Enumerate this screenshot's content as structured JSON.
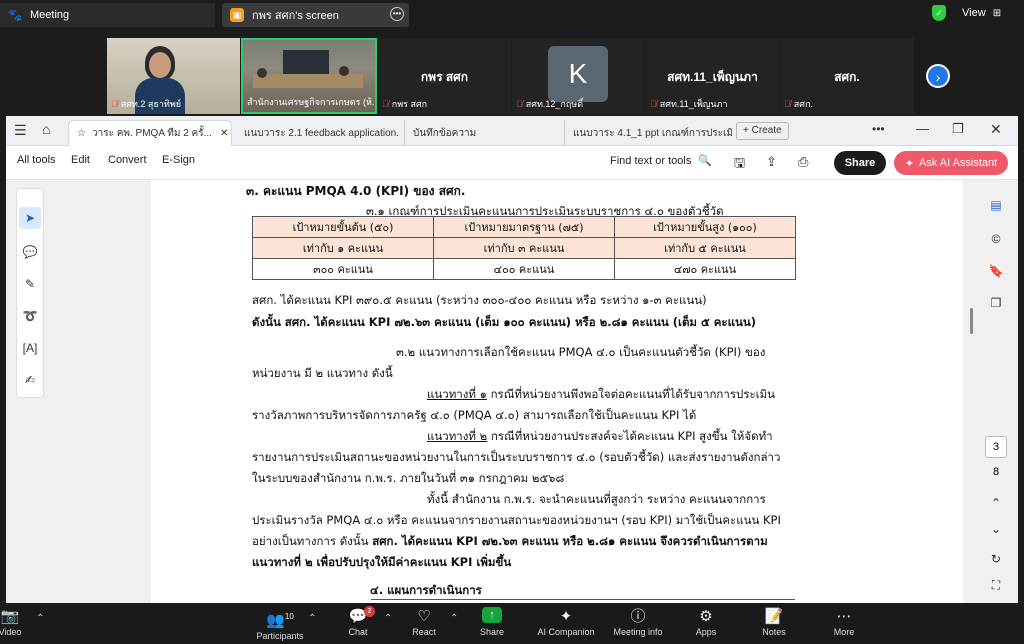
{
  "zoom_top": {
    "meeting_label": "Meeting",
    "share_label": "กพร สศก's screen",
    "view_label": "View"
  },
  "gallery": {
    "tiles": [
      {
        "name": "สศท.2 สุธาทิพย์"
      },
      {
        "name": "สำนักงานเศรษฐกิจการเกษตร (ห้..."
      },
      {
        "title": "กพร สศก",
        "name": "กพร สศก"
      },
      {
        "avatar_letter": "K",
        "name": "สศท.12_กฤษดิ์"
      },
      {
        "title": "สศท.11_เพ็ญนภา",
        "name": "สศท.11_เพ็ญนภา"
      },
      {
        "title": "สศก.",
        "name": "สศก."
      }
    ]
  },
  "browser": {
    "tabs": [
      "วาระ คพ. PMQA ทีม 2 ครั้...",
      "แนบวาระ 2.1 feedback application...",
      "บันทึกข้อความ",
      "แนบวาระ 4.1_1 ppt เกณฑ์การประเมิน ...",
      "Create"
    ],
    "menu": [
      "All tools",
      "Edit",
      "Convert",
      "E-Sign"
    ],
    "find_label": "Find text or tools",
    "share_label": "Share",
    "ai_label": "Ask AI Assistant"
  },
  "doc": {
    "h3": "๓. คะแนน PMQA 4.0 (KPI) ของ สศก.",
    "s31": "๓.๑ เกณฑ์การประเมินคะแนนการประเมินระบบราชการ ๔.๐ ของตัวชี้วัด",
    "table": {
      "headers": [
        "เป้าหมายขั้นต้น (๕๐)",
        "เป้าหมายมาตรฐาน (๗๕)",
        "เป้าหมายขั้นสูง (๑๐๐)"
      ],
      "row2": [
        "เท่ากับ ๑ คะแนน",
        "เท่ากับ ๓ คะแนน",
        "เท่ากับ ๕ คะแนน"
      ],
      "row3": [
        "๓๐๐ คะแนน",
        "๔๐๐ คะแนน",
        "๔๗๐ คะแนน"
      ]
    },
    "p1": "สศก. ได้คะแนน KPI ๓๙๐.๕ คะแนน (ระหว่าง ๓๐๐-๔๐๐ คะแนน หรือ ระหว่าง ๑-๓ คะแนน)",
    "p2": "ดังนั้น สศก. ได้คะแนน KPI ๗๒.๖๓ คะแนน (เต็ม ๑๐๐ คะแนน) หรือ ๒.๘๑ คะแนน (เต็ม ๕ คะแนน)",
    "s32a": "๓.๒ แนวทางการเลือกใช้คะแนน PMQA ๔.๐ เป็นคะแนนตัวชี้วัด (KPI) ของ",
    "s32b": "หน่วยงาน มี ๒ แนวทาง ดังนี้",
    "w1_label": "แนวทางที่ ๑",
    "w1_text": "กรณีที่หน่วยงานพึงพอใจต่อคะแนนที่ได้รับจากการประเมิน",
    "w1b": "รางวัลภาพการบริหารจัดการภาครัฐ ๔.๐ (PMQA ๔.๐) สามารถเลือกใช้เป็นคะแนน KPI ได้",
    "w2_label": "แนวทางที่ ๒",
    "w2_text": "กรณีที่หน่วยงานประสงค์จะได้คะแนน KPI สูงขึ้น ให้จัดทำ",
    "w2b": "รายงานการประเมินสถานะของหน่วยงานในการเป็นระบบราชการ ๔.๐ (รอบตัวชี้วัด) และส่งรายงานดังกล่าว",
    "w2c": "ในระบบของสำนักงาน ก.พ.ร. ภายในวันที่ ๓๑ กรกฎาคม ๒๕๖๘",
    "c1": "ทั้งนี้ สำนักงาน ก.พ.ร. จะนำคะแนนที่สูงกว่า ระหว่าง คะแนนจากการ",
    "c2": "ประเมินรางวัล PMQA ๔.๐ หรือ คะแนนจากรายงานสถานะของหน่วยงานฯ (รอบ KPI) มาใช้เป็นคะแนน KPI",
    "c3a": "อย่างเป็นทางการ ดังนั้น",
    "c3b": "สศก. ได้คะแนน KPI ๗๒.๖๓ คะแนน หรือ ๒.๘๑ คะแนน จึงควรดำเนินการตาม",
    "c4": "แนวทางที่ ๒ เพื่อปรับปรุงให้มีค่าคะแนน KPI เพิ่มขึ้น",
    "h4": "๔. แผนการดำเนินการ"
  },
  "pager": {
    "current": "3",
    "total": "8"
  },
  "zoom_bottom": {
    "video": "Video",
    "participants": "Participants",
    "participants_count": "10",
    "chat": "Chat",
    "chat_badge": "2",
    "react": "React",
    "share": "Share",
    "ai": "AI Companion",
    "info": "Meeting info",
    "apps": "Apps",
    "notes": "Notes",
    "more": "More"
  },
  "colors": {
    "share_green": "#1aa33c",
    "ai_button": "#ee5a6b",
    "table_pink": "#fbe4d5"
  }
}
